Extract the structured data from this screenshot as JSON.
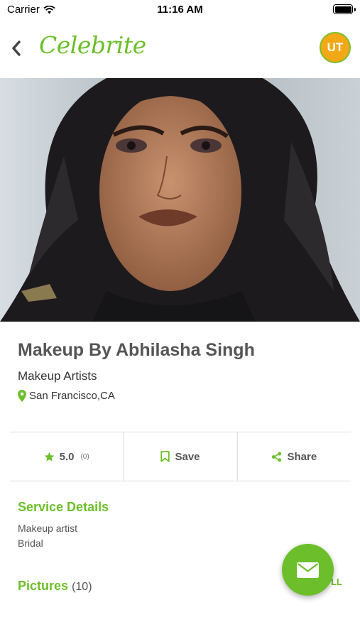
{
  "status_bar": {
    "carrier": "Carrier",
    "time": "11:16 AM"
  },
  "nav": {
    "logo": "Celebrite",
    "avatar_initials": "UT"
  },
  "hero": {
    "icon": "portrait-photo"
  },
  "profile": {
    "name": "Makeup By Abhilasha Singh",
    "category": "Makeup Artists",
    "location": "San Francisco,CA"
  },
  "actions": {
    "rating": "5.0",
    "rating_count": "(0)",
    "save_label": "Save",
    "share_label": "Share"
  },
  "service_details": {
    "title": "Service Details",
    "items": [
      "Makeup artist",
      "Bridal"
    ]
  },
  "pictures": {
    "title": "Pictures",
    "count": "(10)",
    "view_all": "LL"
  },
  "colors": {
    "accent": "#6cbf2a",
    "avatar_bg": "#f2a817"
  }
}
